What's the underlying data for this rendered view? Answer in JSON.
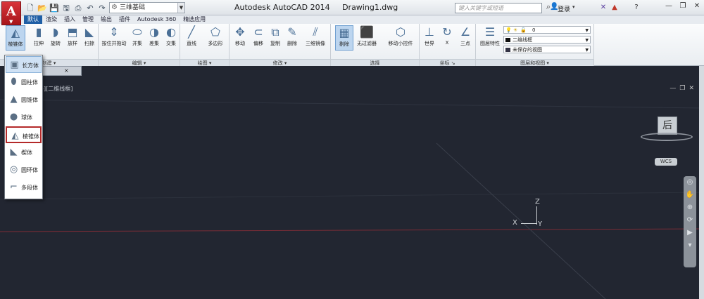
{
  "window": {
    "title": "Autodesk AutoCAD 2014     Drawing1.dwg",
    "workspace": "三维基础",
    "search_placeholder": "键入关键字或短语",
    "login_label": "登录"
  },
  "ribbon": {
    "tabs": [
      {
        "label": "默认",
        "active": true
      },
      {
        "label": "渲染"
      },
      {
        "label": "插入"
      },
      {
        "label": "管理"
      },
      {
        "label": "输出"
      },
      {
        "label": "插件"
      },
      {
        "label": "Autodesk 360"
      },
      {
        "label": "精选应用"
      }
    ],
    "groups": {
      "create": "创建",
      "edit": "编辑",
      "draw": "绘图",
      "modify": "修改",
      "select": "选择",
      "coords": "坐标",
      "layers": "图层和视图"
    },
    "buttons": {
      "pyramid": "棱锥体",
      "extrude": "拉伸",
      "revolve": "旋转",
      "loft": "放样",
      "sweep": "扫掠",
      "presspull": "按住并拖动",
      "union": "并集",
      "subtract": "差集",
      "intersect": "交集",
      "line": "直线",
      "polygon": "多边形",
      "move": "移动",
      "offset": "偏移",
      "copy": "复制",
      "erase": "删除",
      "mirror3d": "三维镜像",
      "culling": "剔除",
      "nofilter": "无过滤器",
      "gizmo": "移动小控件",
      "world": "世界",
      "x": "X",
      "threepoint": "三点",
      "layer_props": "图层特性"
    },
    "layers": {
      "current_layer": "0",
      "visual_style": "二维线框",
      "view": "未保存的视图"
    }
  },
  "drawing": {
    "viewport_label": "[-][二维线框]",
    "viewcube_face": "后",
    "wcs": "WCS",
    "axes": {
      "x": "X",
      "y": "Y",
      "z": "Z"
    }
  },
  "dropdown": {
    "items": [
      {
        "label": "长方体",
        "icon": "box-icon"
      },
      {
        "label": "圆柱体",
        "icon": "cylinder-icon"
      },
      {
        "label": "圆锥体",
        "icon": "cone-icon"
      },
      {
        "label": "球体",
        "icon": "sphere-icon"
      },
      {
        "label": "棱锥体",
        "icon": "pyramid-icon"
      },
      {
        "label": "楔体",
        "icon": "wedge-icon"
      },
      {
        "label": "圆环体",
        "icon": "torus-icon"
      },
      {
        "label": "多段体",
        "icon": "polysolid-icon"
      }
    ]
  }
}
